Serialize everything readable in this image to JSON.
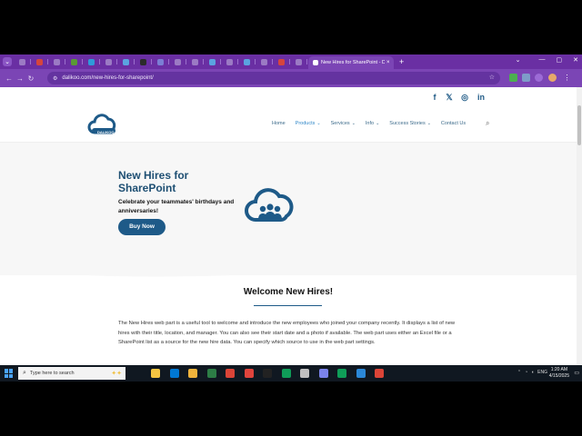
{
  "browser": {
    "active_tab_title": "New Hires for SharePoint - DA...",
    "close_glyph": "×",
    "new_tab_glyph": "+",
    "url": "dalikoo.com/new-hires-for-sharepoint/",
    "tab_favicon_colors": [
      "#9b7ac4",
      "#d6453d",
      "#9b7ac4",
      "#5a9a35",
      "#2f9ad9",
      "#9b7ac4",
      "#5ba3e0",
      "#2b2b2b",
      "#7b7ed4",
      "#9b7ac4",
      "#9b7ac4",
      "#5ba3e0",
      "#9b7ac4",
      "#5ba3e0",
      "#9b7ac4",
      "#d6453d",
      "#9b7ac4"
    ],
    "accent": "#6a2fa3"
  },
  "site": {
    "logo_text": "DALIKOO",
    "social": [
      "f",
      "𝕏",
      "◎",
      "in"
    ],
    "nav": [
      {
        "label": "Home",
        "dropdown": false,
        "active": false
      },
      {
        "label": "Products",
        "dropdown": true,
        "active": true
      },
      {
        "label": "Services",
        "dropdown": true,
        "active": false
      },
      {
        "label": "Info",
        "dropdown": true,
        "active": false
      },
      {
        "label": "Success Stories",
        "dropdown": true,
        "active": false
      },
      {
        "label": "Contact Us",
        "dropdown": false,
        "active": false
      }
    ],
    "brand_color": "#1e5a88"
  },
  "hero": {
    "title": "New Hires for SharePoint",
    "subtitle": "Celebrate your teammates' birthdays and anniversaries!",
    "button": "Buy Now"
  },
  "content": {
    "heading": "Welcome New Hires!",
    "paragraph": "The New Hires web part is a useful tool to welcome and introduce the new employees who joined your company recently. It displays a list of new hires with their title, location, and manager. You can also see their start date and a photo if available. The web part uses either an Excel file or a SharePoint list as a source for the new hire data. You can specify which source to use in the web part settings."
  },
  "taskbar": {
    "search_placeholder": "Type here to search",
    "tray_label": "ENG",
    "time": "1:20 AM",
    "date": "4/15/2025",
    "app_colors": [
      "#f5c542",
      "#0078d4",
      "#f0b43c",
      "#2d7d46",
      "#db4437",
      "#e0443c",
      "#222222",
      "#0f9d58",
      "#c0c0c0",
      "#7b83eb",
      "#0f9d58",
      "#2b88d8",
      "#db4437"
    ]
  }
}
